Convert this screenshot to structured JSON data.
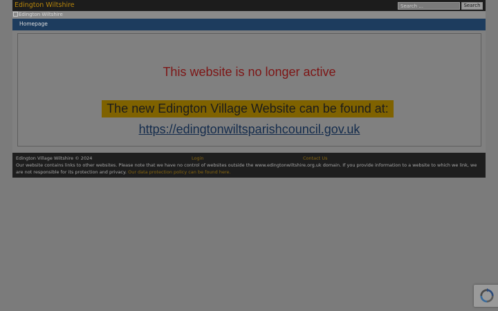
{
  "header": {
    "site_title": "Edington Wiltshire",
    "search_placeholder": "Search ...",
    "search_button": "Search"
  },
  "logo": {
    "alt_text": "Edington Wiltshire"
  },
  "nav": {
    "items": [
      {
        "label": "Homepage"
      }
    ]
  },
  "main": {
    "notice": "This website is no longer active",
    "banner": "The new Edington Village Website can be found at:",
    "link": "https://edingtonwiltsparishcouncil.gov.uk"
  },
  "footer": {
    "copyright": "Edington Village Wiltshire © 2024",
    "login": "Login",
    "contact": "Contact Us",
    "disclaimer": "Our website contains links to other websites. Please note that we have no control of websites outside the www.edingtonwiltshire.org.uk domain. If you provide information to a website to which we link, we are not responsible for its protection and privacy.",
    "privacy_link": "Our data protection policy can be found here."
  },
  "colors": {
    "accent": "#b8860b",
    "nav": "#1d3c5e",
    "notice": "#7d1515",
    "banner": "#7f6200"
  },
  "icons": {
    "recaptcha": "recaptcha-icon"
  }
}
